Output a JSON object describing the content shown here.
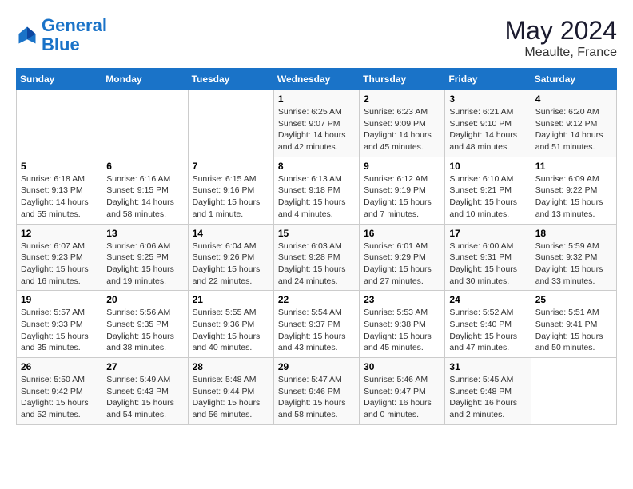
{
  "logo": {
    "line1": "General",
    "line2": "Blue"
  },
  "header": {
    "month_year": "May 2024",
    "location": "Meaulte, France"
  },
  "days_of_week": [
    "Sunday",
    "Monday",
    "Tuesday",
    "Wednesday",
    "Thursday",
    "Friday",
    "Saturday"
  ],
  "weeks": [
    [
      {
        "day": "",
        "info": ""
      },
      {
        "day": "",
        "info": ""
      },
      {
        "day": "",
        "info": ""
      },
      {
        "day": "1",
        "info": "Sunrise: 6:25 AM\nSunset: 9:07 PM\nDaylight: 14 hours\nand 42 minutes."
      },
      {
        "day": "2",
        "info": "Sunrise: 6:23 AM\nSunset: 9:09 PM\nDaylight: 14 hours\nand 45 minutes."
      },
      {
        "day": "3",
        "info": "Sunrise: 6:21 AM\nSunset: 9:10 PM\nDaylight: 14 hours\nand 48 minutes."
      },
      {
        "day": "4",
        "info": "Sunrise: 6:20 AM\nSunset: 9:12 PM\nDaylight: 14 hours\nand 51 minutes."
      }
    ],
    [
      {
        "day": "5",
        "info": "Sunrise: 6:18 AM\nSunset: 9:13 PM\nDaylight: 14 hours\nand 55 minutes."
      },
      {
        "day": "6",
        "info": "Sunrise: 6:16 AM\nSunset: 9:15 PM\nDaylight: 14 hours\nand 58 minutes."
      },
      {
        "day": "7",
        "info": "Sunrise: 6:15 AM\nSunset: 9:16 PM\nDaylight: 15 hours\nand 1 minute."
      },
      {
        "day": "8",
        "info": "Sunrise: 6:13 AM\nSunset: 9:18 PM\nDaylight: 15 hours\nand 4 minutes."
      },
      {
        "day": "9",
        "info": "Sunrise: 6:12 AM\nSunset: 9:19 PM\nDaylight: 15 hours\nand 7 minutes."
      },
      {
        "day": "10",
        "info": "Sunrise: 6:10 AM\nSunset: 9:21 PM\nDaylight: 15 hours\nand 10 minutes."
      },
      {
        "day": "11",
        "info": "Sunrise: 6:09 AM\nSunset: 9:22 PM\nDaylight: 15 hours\nand 13 minutes."
      }
    ],
    [
      {
        "day": "12",
        "info": "Sunrise: 6:07 AM\nSunset: 9:23 PM\nDaylight: 15 hours\nand 16 minutes."
      },
      {
        "day": "13",
        "info": "Sunrise: 6:06 AM\nSunset: 9:25 PM\nDaylight: 15 hours\nand 19 minutes."
      },
      {
        "day": "14",
        "info": "Sunrise: 6:04 AM\nSunset: 9:26 PM\nDaylight: 15 hours\nand 22 minutes."
      },
      {
        "day": "15",
        "info": "Sunrise: 6:03 AM\nSunset: 9:28 PM\nDaylight: 15 hours\nand 24 minutes."
      },
      {
        "day": "16",
        "info": "Sunrise: 6:01 AM\nSunset: 9:29 PM\nDaylight: 15 hours\nand 27 minutes."
      },
      {
        "day": "17",
        "info": "Sunrise: 6:00 AM\nSunset: 9:31 PM\nDaylight: 15 hours\nand 30 minutes."
      },
      {
        "day": "18",
        "info": "Sunrise: 5:59 AM\nSunset: 9:32 PM\nDaylight: 15 hours\nand 33 minutes."
      }
    ],
    [
      {
        "day": "19",
        "info": "Sunrise: 5:57 AM\nSunset: 9:33 PM\nDaylight: 15 hours\nand 35 minutes."
      },
      {
        "day": "20",
        "info": "Sunrise: 5:56 AM\nSunset: 9:35 PM\nDaylight: 15 hours\nand 38 minutes."
      },
      {
        "day": "21",
        "info": "Sunrise: 5:55 AM\nSunset: 9:36 PM\nDaylight: 15 hours\nand 40 minutes."
      },
      {
        "day": "22",
        "info": "Sunrise: 5:54 AM\nSunset: 9:37 PM\nDaylight: 15 hours\nand 43 minutes."
      },
      {
        "day": "23",
        "info": "Sunrise: 5:53 AM\nSunset: 9:38 PM\nDaylight: 15 hours\nand 45 minutes."
      },
      {
        "day": "24",
        "info": "Sunrise: 5:52 AM\nSunset: 9:40 PM\nDaylight: 15 hours\nand 47 minutes."
      },
      {
        "day": "25",
        "info": "Sunrise: 5:51 AM\nSunset: 9:41 PM\nDaylight: 15 hours\nand 50 minutes."
      }
    ],
    [
      {
        "day": "26",
        "info": "Sunrise: 5:50 AM\nSunset: 9:42 PM\nDaylight: 15 hours\nand 52 minutes."
      },
      {
        "day": "27",
        "info": "Sunrise: 5:49 AM\nSunset: 9:43 PM\nDaylight: 15 hours\nand 54 minutes."
      },
      {
        "day": "28",
        "info": "Sunrise: 5:48 AM\nSunset: 9:44 PM\nDaylight: 15 hours\nand 56 minutes."
      },
      {
        "day": "29",
        "info": "Sunrise: 5:47 AM\nSunset: 9:46 PM\nDaylight: 15 hours\nand 58 minutes."
      },
      {
        "day": "30",
        "info": "Sunrise: 5:46 AM\nSunset: 9:47 PM\nDaylight: 16 hours\nand 0 minutes."
      },
      {
        "day": "31",
        "info": "Sunrise: 5:45 AM\nSunset: 9:48 PM\nDaylight: 16 hours\nand 2 minutes."
      },
      {
        "day": "",
        "info": ""
      }
    ]
  ]
}
